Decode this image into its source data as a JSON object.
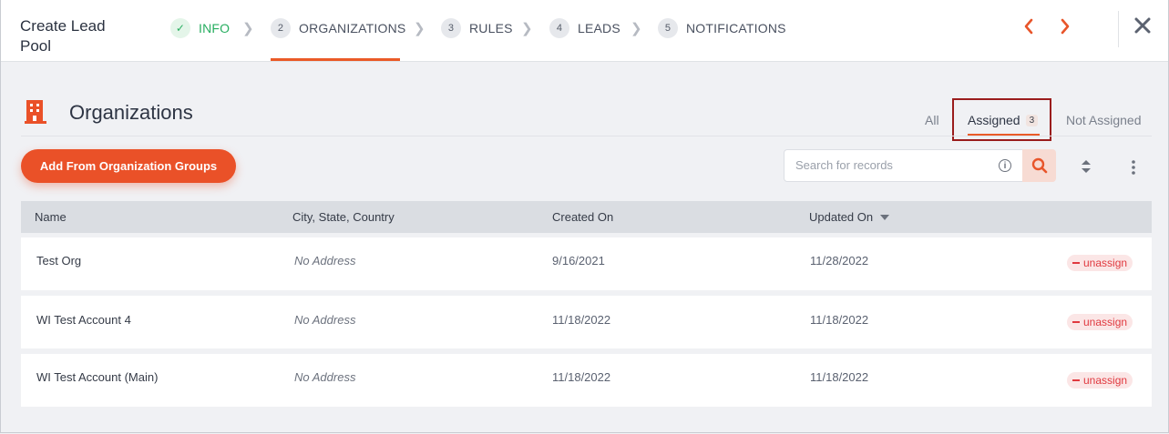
{
  "header": {
    "title": "Create Lead Pool",
    "steps": [
      {
        "number": "✓",
        "label": "INFO"
      },
      {
        "number": "2",
        "label": "ORGANIZATIONS"
      },
      {
        "number": "3",
        "label": "RULES"
      },
      {
        "number": "4",
        "label": "LEADS"
      },
      {
        "number": "5",
        "label": "NOTIFICATIONS"
      }
    ],
    "active_step": "ORGANIZATIONS",
    "prev_icon": "chevron-left-icon",
    "next_icon": "chevron-right-icon",
    "close_icon": "close-icon"
  },
  "section": {
    "icon": "building-icon",
    "title": "Organizations",
    "tabs": {
      "all": "All",
      "assigned": "Assigned",
      "assigned_count": "3",
      "not_assigned": "Not Assigned"
    }
  },
  "toolbar": {
    "add_button": "Add From Organization Groups",
    "search_placeholder": "Search for records",
    "search_value": ""
  },
  "table": {
    "columns": [
      "Name",
      "City, State, Country",
      "Created On",
      "Updated On"
    ],
    "sorted_column": "Updated On",
    "rows": [
      {
        "name": "Test Org",
        "location": "No Address",
        "created": "9/16/2021",
        "updated": "11/28/2022",
        "action": "unassign"
      },
      {
        "name": "WI Test Account 4",
        "location": "No Address",
        "created": "11/18/2022",
        "updated": "11/18/2022",
        "action": "unassign"
      },
      {
        "name": "WI Test Account (Main)",
        "location": "No Address",
        "created": "11/18/2022",
        "updated": "11/18/2022",
        "action": "unassign"
      }
    ]
  },
  "colors": {
    "accent": "#ea5128",
    "success": "#27ae60",
    "danger": "#e0393f",
    "highlight_box": "#9a1c1c"
  }
}
